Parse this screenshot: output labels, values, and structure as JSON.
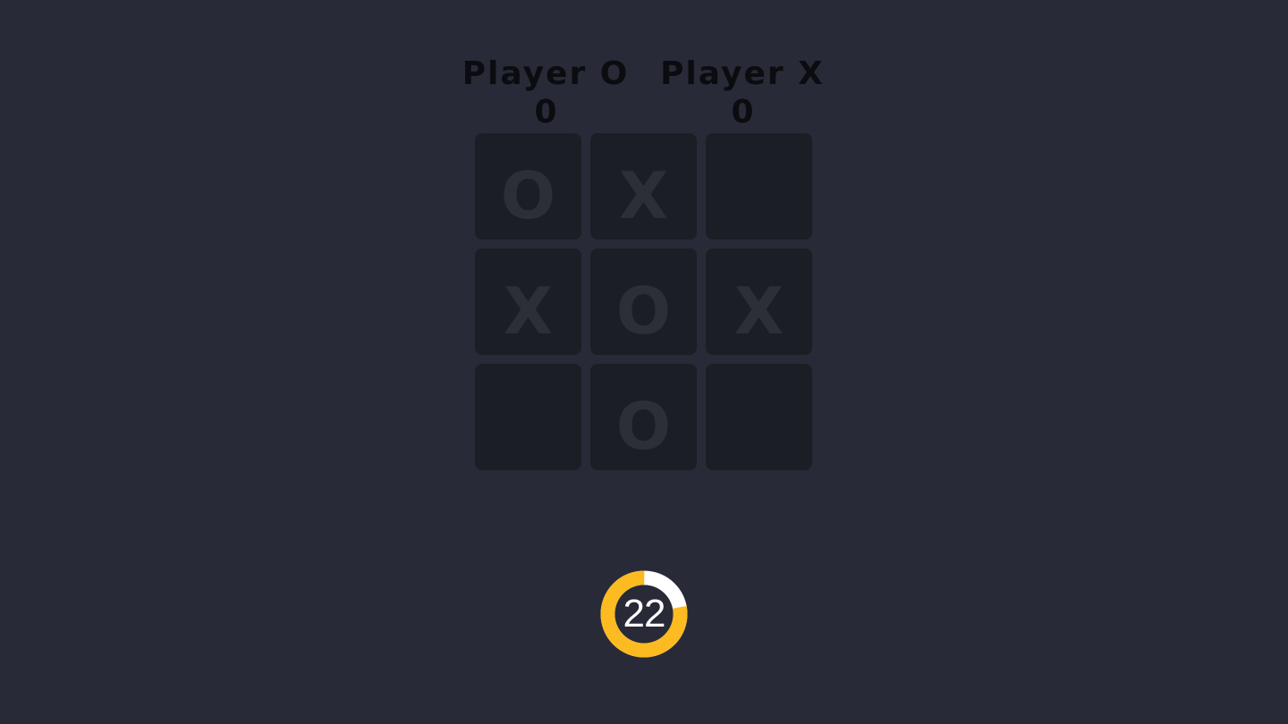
{
  "scoreboard": {
    "player_o": {
      "name": "Player O",
      "score": "0"
    },
    "player_x": {
      "name": "Player X",
      "score": "0"
    }
  },
  "board": {
    "cells": [
      "O",
      "X",
      "",
      "X",
      "O",
      "X",
      "",
      "O",
      ""
    ]
  },
  "timer": {
    "value": "22",
    "fraction_remaining": 0.78,
    "accent_color": "#fbbb21",
    "track_color": "#ffffff"
  }
}
